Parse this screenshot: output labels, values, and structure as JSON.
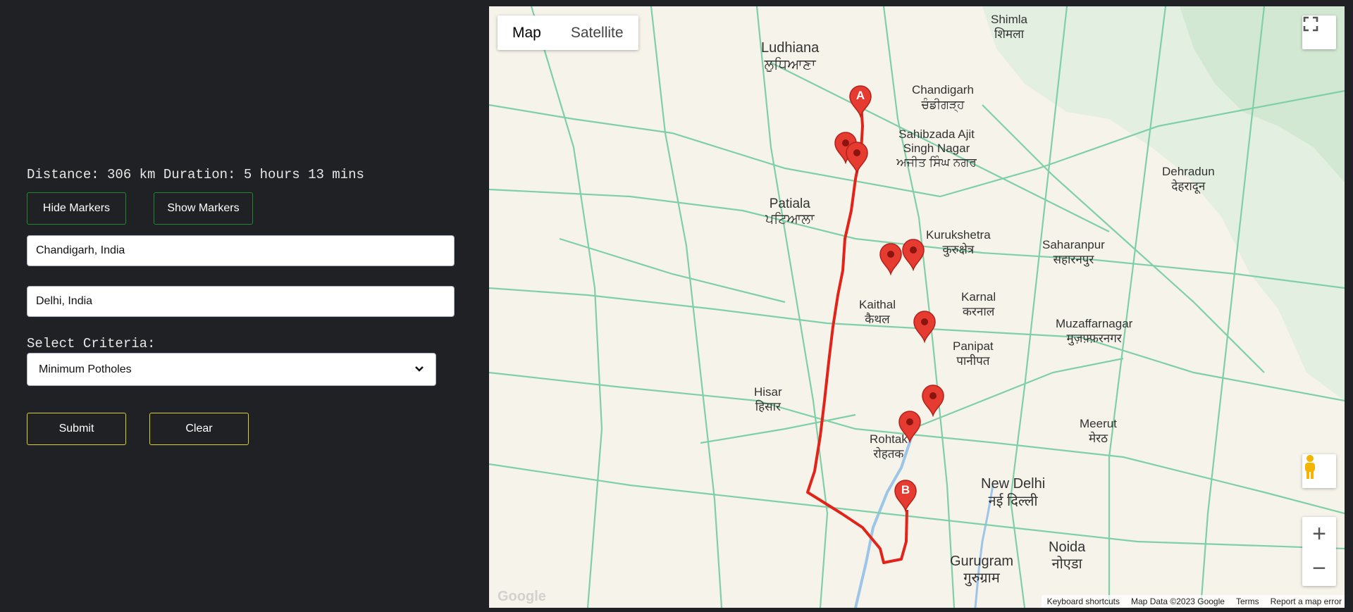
{
  "summary": {
    "text": "Distance: 306 km Duration: 5 hours 13 mins"
  },
  "buttons": {
    "hide_markers": "Hide Markers",
    "show_markers": "Show Markers",
    "submit": "Submit",
    "clear": "Clear"
  },
  "inputs": {
    "origin": "Chandigarh, India",
    "destination": "Delhi, India"
  },
  "criteria": {
    "label": "Select Criteria:",
    "selected": "Minimum Potholes"
  },
  "map": {
    "type_control": [
      "Map",
      "Satellite"
    ],
    "active_type": "Map",
    "marker_a": "A",
    "marker_b": "B",
    "attribution": [
      "Keyboard shortcuts",
      "Map Data ©2023 Google",
      "Terms",
      "Report a map error"
    ],
    "cities": [
      {
        "name": "Ludhiana",
        "native": "ਲੁਧਿਆਣਾ"
      },
      {
        "name": "Shimla",
        "native": "शिमला"
      },
      {
        "name": "Chandigarh",
        "native": "ਚੰਡੀਗੜ੍ਹ"
      },
      {
        "name": "Sahibzada Ajit Singh Nagar",
        "native": "ਅਜੀਤ ਸਿੰਘ ਨਗਰ"
      },
      {
        "name": "Patiala",
        "native": "ਪਟਿਆਲਾ"
      },
      {
        "name": "Kurukshetra",
        "native": "कुरुक्षेत्र"
      },
      {
        "name": "Saharanpur",
        "native": "सहारनपुर"
      },
      {
        "name": "Dehradun",
        "native": "देहरादून"
      },
      {
        "name": "Kaithal",
        "native": "कैथल"
      },
      {
        "name": "Karnal",
        "native": "करनाल"
      },
      {
        "name": "Panipat",
        "native": "पानीपत"
      },
      {
        "name": "Muzaffarnagar",
        "native": "मुज़फ़्फ़रनगर"
      },
      {
        "name": "Hisar",
        "native": "हिसार"
      },
      {
        "name": "Rohtak",
        "native": "रोहतक"
      },
      {
        "name": "Meerut",
        "native": "मेरठ"
      },
      {
        "name": "New Delhi",
        "native": "नई दिल्ली"
      },
      {
        "name": "Noida",
        "native": "नोएडा"
      },
      {
        "name": "Gurugram",
        "native": "गुरुग्राम"
      }
    ]
  }
}
